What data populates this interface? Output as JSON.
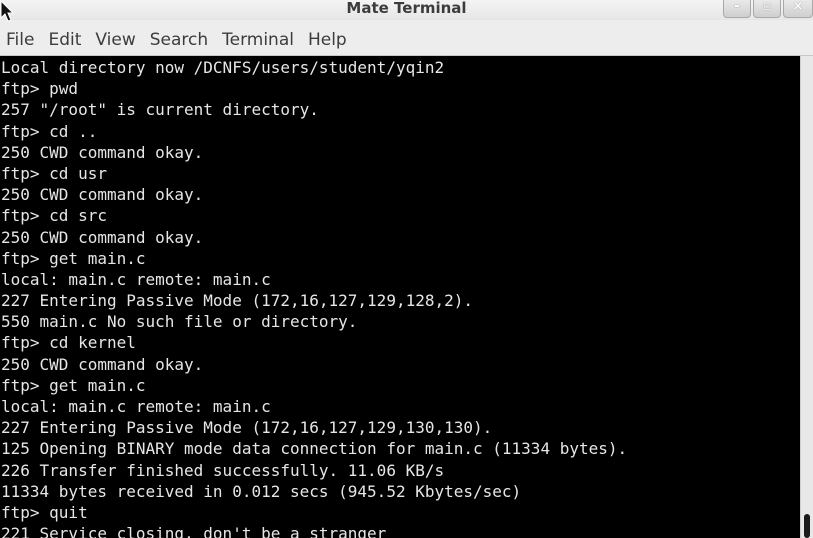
{
  "window": {
    "title": "Mate Terminal",
    "buttons": {
      "minimize": "-",
      "maximize": "▫",
      "close": "×"
    }
  },
  "menu": [
    "File",
    "Edit",
    "View",
    "Search",
    "Terminal",
    "Help"
  ],
  "terminal": {
    "lines": [
      "Local directory now /DCNFS/users/student/yqin2",
      "ftp> pwd",
      "257 \"/root\" is current directory.",
      "ftp> cd ..",
      "250 CWD command okay.",
      "ftp> cd usr",
      "250 CWD command okay.",
      "ftp> cd src",
      "250 CWD command okay.",
      "ftp> get main.c",
      "local: main.c remote: main.c",
      "227 Entering Passive Mode (172,16,127,129,128,2).",
      "550 main.c No such file or directory.",
      "ftp> cd kernel",
      "250 CWD command okay.",
      "ftp> get main.c",
      "local: main.c remote: main.c",
      "227 Entering Passive Mode (172,16,127,129,130,130).",
      "125 Opening BINARY mode data connection for main.c (11334 bytes).",
      "226 Transfer finished successfully. 11.06 KB/s",
      "11334 bytes received in 0.012 secs (945.52 Kbytes/sec)",
      "ftp> quit",
      "221 Service closing, don't be a stranger"
    ]
  },
  "colors": {
    "terminal_bg": "#000000",
    "terminal_fg": "#e6e6e6",
    "chrome": "#ededed"
  }
}
